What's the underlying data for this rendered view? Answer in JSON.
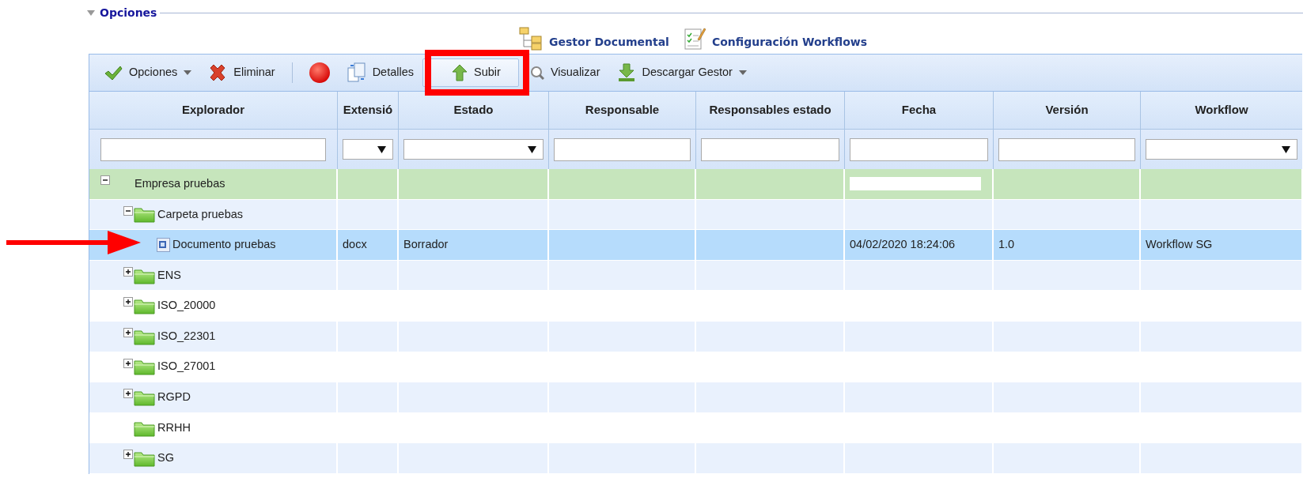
{
  "section": {
    "title": "Opciones"
  },
  "links": [
    {
      "label": "Gestor Documental",
      "kind": "tree"
    },
    {
      "label": "Configuración Workflows",
      "kind": "checklist"
    }
  ],
  "toolbar": [
    {
      "kind": "button",
      "label": "Opciones",
      "dropdown": true,
      "hovered": false
    },
    {
      "kind": "button",
      "label": "Eliminar",
      "dropdown": false,
      "hovered": false
    },
    {
      "kind": "separator"
    },
    {
      "kind": "icon"
    },
    {
      "kind": "button",
      "label": "Detalles",
      "dropdown": false,
      "hovered": false
    },
    {
      "kind": "button",
      "label": "Subir",
      "dropdown": false,
      "hovered": true
    },
    {
      "kind": "button",
      "label": "Visualizar",
      "dropdown": false,
      "hovered": false
    },
    {
      "kind": "button",
      "label": "Descargar Gestor",
      "dropdown": true,
      "hovered": false
    }
  ],
  "columns": [
    {
      "title": "Explorador",
      "kind": "text"
    },
    {
      "title": "Extensió",
      "kind": "select"
    },
    {
      "title": "Estado",
      "kind": "select"
    },
    {
      "title": "Responsable",
      "kind": "text"
    },
    {
      "title": "Responsables estado",
      "kind": "text"
    },
    {
      "title": "Fecha",
      "kind": "text"
    },
    {
      "title": "Versión",
      "kind": "text"
    },
    {
      "title": "Workflow",
      "kind": "select"
    }
  ],
  "tree": [
    {
      "label": "Empresa pruebas",
      "kind": "root",
      "expanded": true,
      "selected": false,
      "date_box": true,
      "children": [
        {
          "label": "Carpeta pruebas",
          "kind": "folder",
          "expanded": true,
          "selected": false,
          "children": [
            {
              "label": "Documento pruebas",
              "kind": "document",
              "selected": true,
              "extension": "docx",
              "estado": "Borrador",
              "fecha": "04/02/2020 18:24:06",
              "version": "1.0",
              "workflow": "Workflow SG"
            }
          ]
        },
        {
          "label": "ENS",
          "kind": "folder",
          "expanded": false,
          "selected": false
        },
        {
          "label": "ISO_20000",
          "kind": "folder",
          "expanded": false,
          "selected": false
        },
        {
          "label": "ISO_22301",
          "kind": "folder",
          "expanded": false,
          "selected": false
        },
        {
          "label": "ISO_27001",
          "kind": "folder",
          "expanded": false,
          "selected": false
        },
        {
          "label": "RGPD",
          "kind": "folder",
          "expanded": false,
          "selected": false
        },
        {
          "label": "RRHH",
          "kind": "folder",
          "selected": false
        },
        {
          "label": "SG",
          "kind": "folder",
          "expanded": false,
          "selected": false
        }
      ]
    }
  ]
}
